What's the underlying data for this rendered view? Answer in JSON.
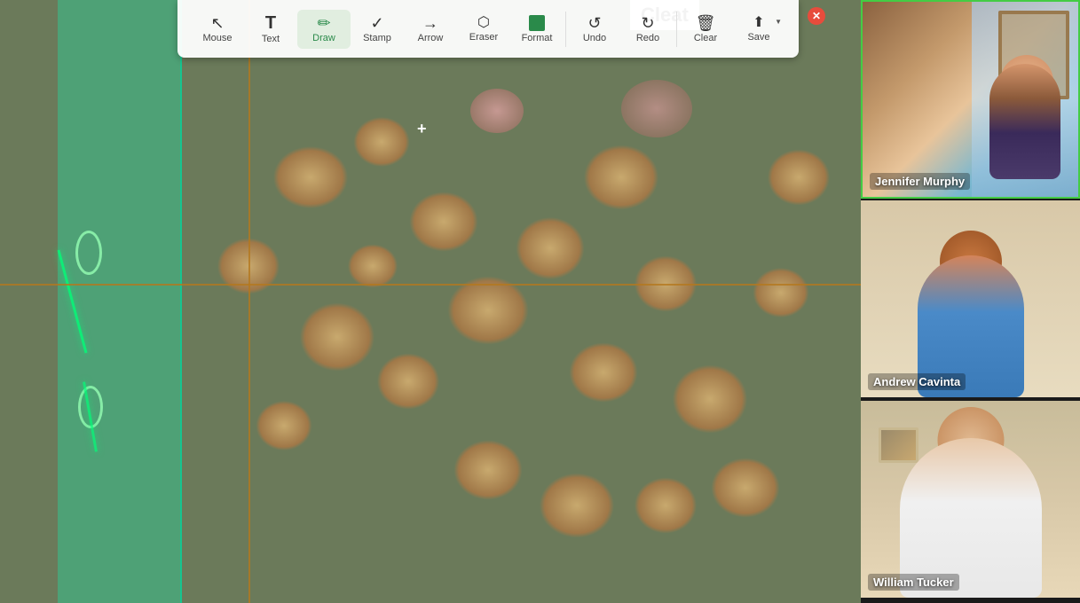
{
  "toolbar": {
    "title": "Cleat",
    "items": [
      {
        "id": "mouse",
        "label": "Mouse",
        "icon": "↖",
        "active": false
      },
      {
        "id": "text",
        "label": "Text",
        "icon": "T",
        "active": false
      },
      {
        "id": "draw",
        "label": "Draw",
        "icon": "✏",
        "active": true
      },
      {
        "id": "stamp",
        "label": "Stamp",
        "icon": "✓",
        "active": false
      },
      {
        "id": "arrow",
        "label": "Arrow",
        "icon": "→",
        "active": false
      },
      {
        "id": "eraser",
        "label": "Eraser",
        "icon": "◇",
        "active": false
      },
      {
        "id": "format",
        "label": "Format",
        "icon": "■",
        "active": false
      },
      {
        "id": "undo",
        "label": "Undo",
        "icon": "↺",
        "active": false
      },
      {
        "id": "redo",
        "label": "Redo",
        "icon": "↻",
        "active": false
      },
      {
        "id": "clear",
        "label": "Clear",
        "icon": "🗑",
        "active": false
      },
      {
        "id": "save",
        "label": "Save",
        "icon": "⬆",
        "active": false
      }
    ],
    "close_icon": "✕"
  },
  "participants": [
    {
      "id": "jennifer-murphy",
      "name": "Jennifer Murphy",
      "active": true
    },
    {
      "id": "andrew-cavinta",
      "name": "Andrew Cavinta",
      "active": false
    },
    {
      "id": "william-tucker",
      "name": "William Tucker",
      "active": false
    }
  ],
  "cleat_label": "Cleat"
}
